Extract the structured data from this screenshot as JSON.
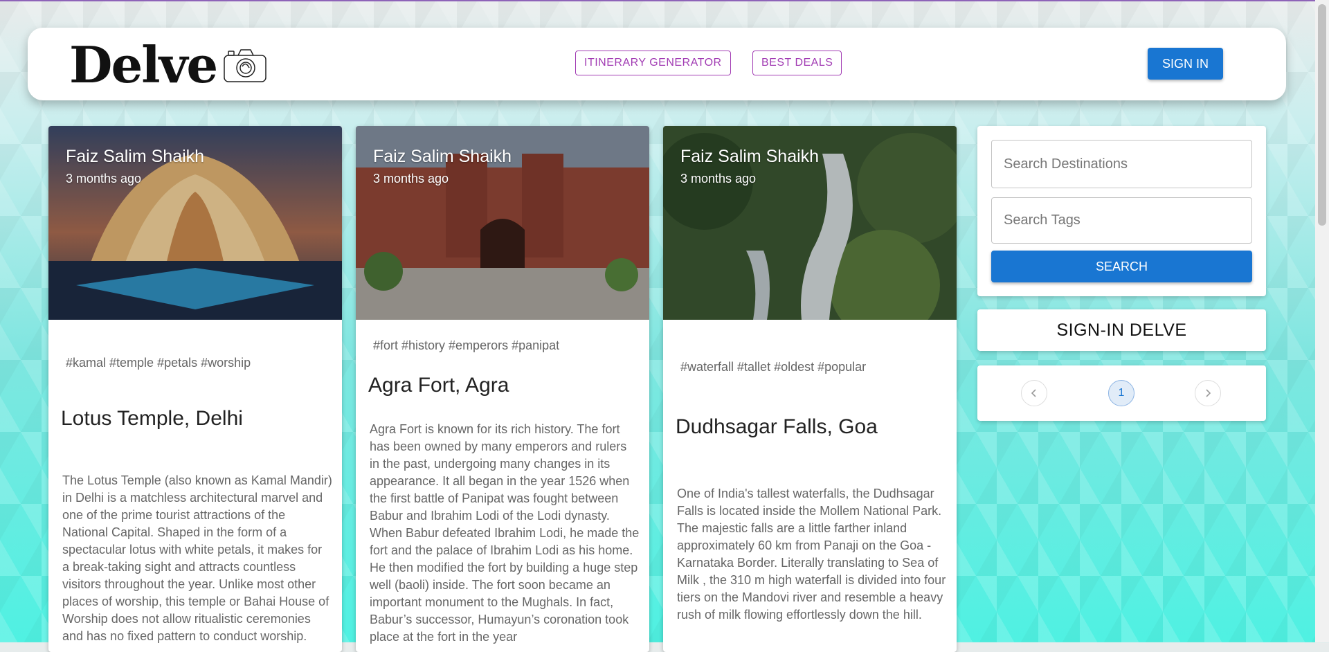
{
  "app": {
    "logo": "Delve"
  },
  "nav": {
    "itinerary_label": "ITINERARY GENERATOR",
    "deals_label": "BEST DEALS",
    "signin_label": "SIGN IN"
  },
  "cards": [
    {
      "author": "Faiz Salim Shaikh",
      "time": "3 months ago",
      "tags": "#kamal #temple #petals #worship",
      "title": "Lotus Temple, Delhi",
      "description": "The Lotus Temple (also known as Kamal Mandir) in Delhi is a matchless architectural marvel and one of the prime tourist attractions of the National Capital. Shaped in the form of a spectacular lotus with white petals, it makes for a break-taking sight and attracts countless visitors throughout the year. Unlike most other places of worship, this temple or Bahai House of Worship does not allow ritualistic ceremonies and has no fixed pattern to conduct worship."
    },
    {
      "author": "Faiz Salim Shaikh",
      "time": "3 months ago",
      "tags": "#fort #history #emperors #panipat",
      "title": "Agra Fort, Agra",
      "description": "Agra Fort is known for its rich history. The fort has been owned by many emperors and rulers in the past, undergoing many changes in its appearance. It all began in the year 1526 when the first battle of Panipat was fought between Babur and Ibrahim Lodi of the Lodi dynasty. When Babur defeated Ibrahim Lodi, he made the fort and the palace of Ibrahim Lodi as his home. He then modified the fort by building a huge step well (baoli) inside. The fort soon became an important monument to the Mughals. In fact, Babur’s successor, Humayun’s coronation took place at the fort in the year"
    },
    {
      "author": "Faiz Salim Shaikh",
      "time": "3 months ago",
      "tags": "#waterfall #tallet #oldest #popular",
      "title": "Dudhsagar Falls, Goa",
      "description": "One of India's tallest waterfalls, the Dudhsagar Falls is located inside the Mollem National Park. The majestic falls are a little farther inland approximately 60 km from Panaji on the Goa - Karnataka Border. Literally translating to Sea of Milk , the 310 m high waterfall is divided into four tiers on the Mandovi river and resemble a heavy rush of milk flowing effortlessly down the hill."
    }
  ],
  "search": {
    "destinations_placeholder": "Search Destinations",
    "tags_placeholder": "Search Tags",
    "button_label": "SEARCH"
  },
  "signin_delve": {
    "label": "SIGN-IN DELVE"
  },
  "pagination": {
    "current_page": "1",
    "prev_icon": "chevron-left",
    "next_icon": "chevron-right"
  },
  "colors": {
    "primary": "#1976d2",
    "accent": "#a13bb3"
  }
}
